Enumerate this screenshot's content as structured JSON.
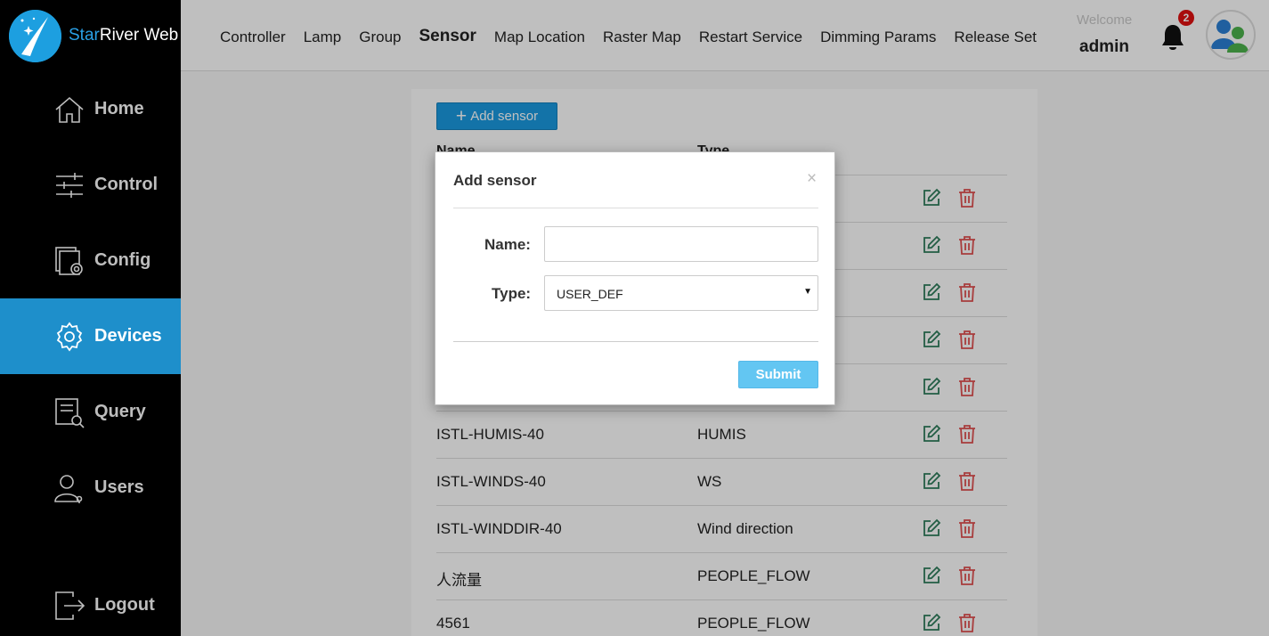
{
  "brand": {
    "part1": "Star",
    "part2": "River Web"
  },
  "sidebar": {
    "items": [
      {
        "label": "Home",
        "icon": "home-icon",
        "active": false
      },
      {
        "label": "Control",
        "icon": "sliders-icon",
        "active": false
      },
      {
        "label": "Config",
        "icon": "config-icon",
        "active": false
      },
      {
        "label": "Devices",
        "icon": "gear-icon",
        "active": true
      },
      {
        "label": "Query",
        "icon": "query-icon",
        "active": false
      },
      {
        "label": "Users",
        "icon": "user-icon",
        "active": false
      }
    ],
    "logout": "Logout"
  },
  "topnav": {
    "items": [
      "Controller",
      "Lamp",
      "Group",
      "Sensor",
      "Map Location",
      "Raster Map",
      "Restart Service",
      "Dimming Params",
      "Release Set"
    ],
    "active": "Sensor"
  },
  "user": {
    "welcome": "Welcome",
    "name": "admin",
    "notifications": "2"
  },
  "main": {
    "add_button": "Add sensor",
    "columns": [
      "Name",
      "Type"
    ],
    "rows": [
      {
        "name": "",
        "type": ""
      },
      {
        "name": "",
        "type": ""
      },
      {
        "name": "",
        "type": ""
      },
      {
        "name": "",
        "type": ""
      },
      {
        "name": "",
        "type": ""
      },
      {
        "name": "ISTL-HUMIS-40",
        "type": "HUMIS"
      },
      {
        "name": "ISTL-WINDS-40",
        "type": "WS"
      },
      {
        "name": "ISTL-WINDDIR-40",
        "type": "Wind direction"
      },
      {
        "name": "人流量",
        "type": "PEOPLE_FLOW"
      },
      {
        "name": "4561",
        "type": "PEOPLE_FLOW"
      }
    ]
  },
  "modal": {
    "title": "Add sensor",
    "close": "×",
    "name_label": "Name:",
    "name_value": "",
    "type_label": "Type:",
    "type_value": "USER_DEF",
    "submit": "Submit"
  },
  "colors": {
    "accent": "#1e8fcb",
    "sidebar_bg": "#000000",
    "submit": "#63c6f2",
    "edit_icon": "#2e7d5b",
    "delete_icon": "#e05050",
    "badge": "#e01010"
  }
}
